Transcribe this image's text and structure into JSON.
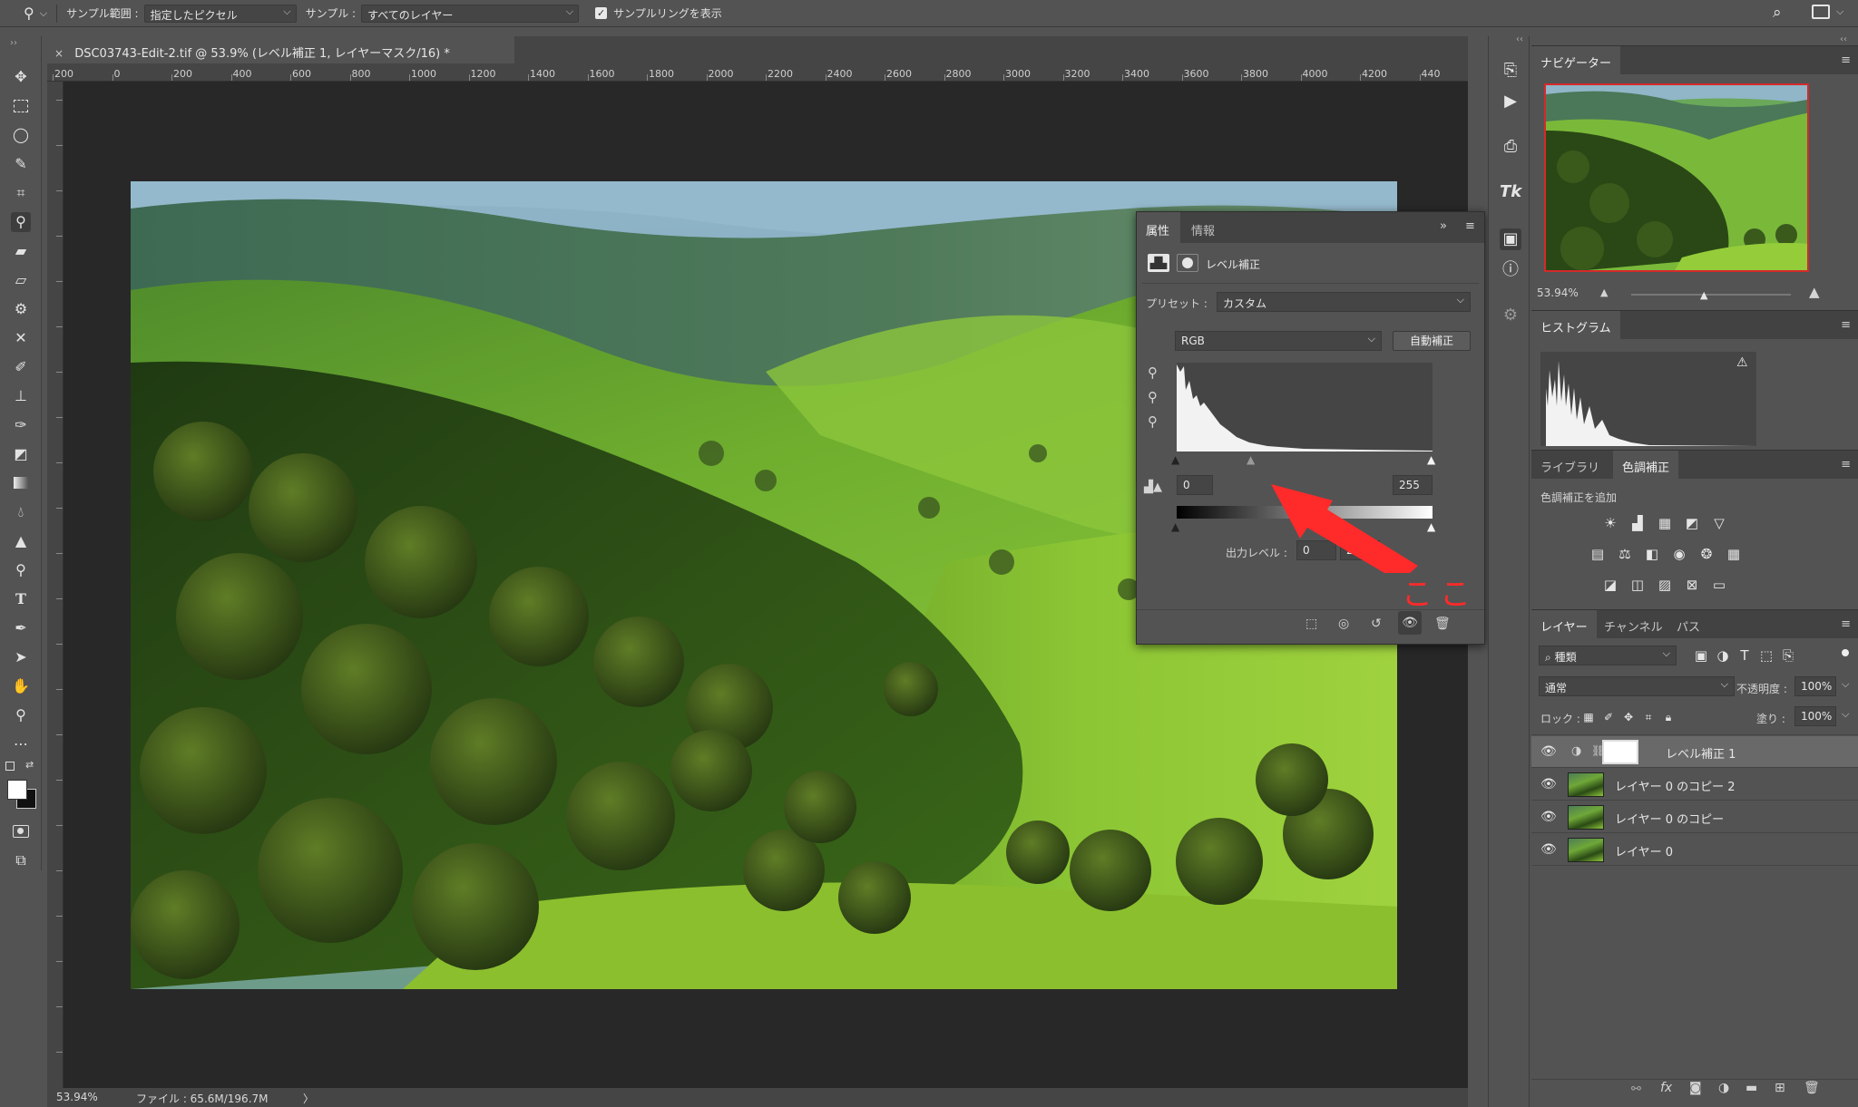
{
  "options_bar": {
    "sample_size_label": "サンプル範囲 :",
    "sample_size_value": "指定したピクセル",
    "sample_label": "サンプル :",
    "sample_value": "すべてのレイヤー",
    "show_ring_label": "サンプルリングを表示",
    "show_ring_checked": true
  },
  "document": {
    "tab_title": "DSC03743-Edit-2.tif @ 53.9% (レベル補正 1, レイヤーマスク/16) *",
    "ruler_labels": [
      "200",
      "0",
      "200",
      "400",
      "600",
      "800",
      "1000",
      "1200",
      "1400",
      "1600",
      "1800",
      "2000",
      "2200",
      "2400",
      "2600",
      "2800",
      "3000",
      "3200",
      "3400",
      "3600",
      "3800",
      "4000",
      "4200",
      "440"
    ]
  },
  "status": {
    "zoom": "53.94%",
    "file_info": "ファイル : 65.6M/196.7M",
    "arrow": "〉"
  },
  "properties": {
    "tabs": [
      "属性",
      "情報"
    ],
    "panel_title": "レベル補正",
    "preset_label": "プリセット :",
    "preset_value": "カスタム",
    "channel": "RGB",
    "auto_button": "自動補正",
    "input_black": "0",
    "input_white": "255",
    "output_label": "出力レベル :",
    "output_black": "0",
    "output_white": "255",
    "annotation": "ここ",
    "annotation_color": "#ff2a2a"
  },
  "navigator": {
    "tab": "ナビゲーター",
    "zoom": "53.94%"
  },
  "histogram": {
    "tab": "ヒストグラム"
  },
  "adjustments": {
    "tabs": [
      "ライブラリ",
      "色調補正"
    ],
    "add_label": "色調補正を追加"
  },
  "layers": {
    "tabs": [
      "レイヤー",
      "チャンネル",
      "パス"
    ],
    "filter_kind": "種類",
    "blend_mode": "通常",
    "opacity_label": "不透明度 :",
    "opacity_value": "100%",
    "lock_label": "ロック :",
    "fill_label": "塗り :",
    "fill_value": "100%",
    "items": [
      {
        "name": "レベル補正 1",
        "type": "adjustment",
        "selected": true
      },
      {
        "name": "レイヤー 0 のコピー 2",
        "type": "pixel",
        "selected": false
      },
      {
        "name": "レイヤー 0 のコピー",
        "type": "pixel",
        "selected": false
      },
      {
        "name": "レイヤー 0",
        "type": "pixel",
        "selected": false
      }
    ],
    "footer_fx": "fx"
  }
}
